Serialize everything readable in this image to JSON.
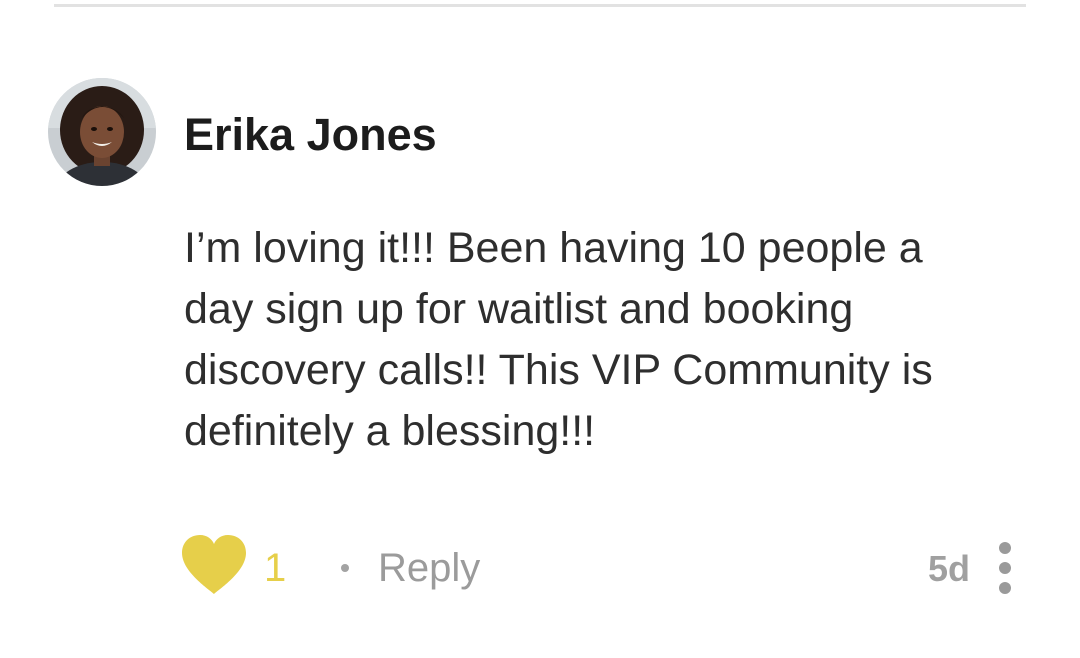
{
  "comment": {
    "author": "Erika Jones",
    "body_lines": [
      "I’m loving it!!! Been having 10 people a",
      "day sign up for waitlist and booking",
      "discovery calls!! This VIP Community is",
      "definitely a blessing!!!"
    ],
    "like_count": "1",
    "reply_label": "Reply",
    "timestamp": "5d"
  },
  "icons": {
    "like": "heart-icon",
    "more": "more-vertical-icon",
    "separator": "dot-separator"
  },
  "colors": {
    "heart": "#e6cf4a",
    "like_count": "#e6cf4a",
    "meta_gray": "#9b9b9b",
    "name": "#1c1c1c",
    "body": "#2e2e2e",
    "divider": "#e2e2e2"
  }
}
